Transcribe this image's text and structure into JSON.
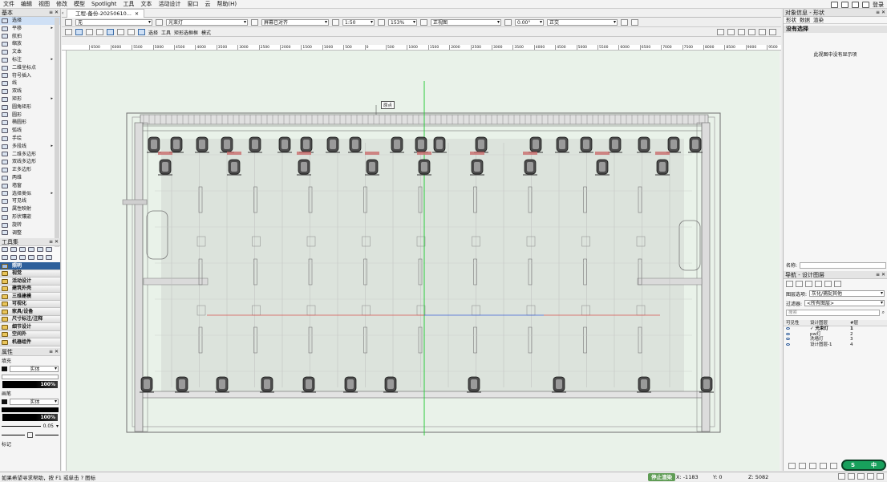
{
  "menubar": {
    "items": [
      "文件",
      "编辑",
      "视图",
      "修改",
      "模型",
      "Spotlight",
      "工具",
      "文本",
      "活动设计",
      "窗口",
      "云",
      "帮助(H)"
    ],
    "login": "登录"
  },
  "left_panel": {
    "basic_title": "基本",
    "basic_tools": [
      "选择",
      "平移",
      "航拍",
      "缩放",
      "文本",
      "标注",
      "二维坐标点",
      "符号插入",
      "线",
      "双线",
      "矩形",
      "圆角矩形",
      "圆形",
      "椭圆形",
      "弧线",
      "手绘",
      "多段线",
      "二维多边形",
      "双线多边形",
      "正多边形",
      "两维",
      "墙窗",
      "选择类似",
      "可见线",
      "属性映射",
      "形状镶嵌",
      "旋转",
      "调整"
    ],
    "toolsets_title": "工具集",
    "toolsets": [
      "照明",
      "视觉",
      "活动设计",
      "建筑外壳",
      "三维建模",
      "可视化",
      "家具/设备",
      "尺寸标注/注释",
      "细节设计",
      "空间外",
      "机器组件"
    ],
    "selected_toolset": "照明",
    "attributes_title": "属性",
    "fill_label": "填充",
    "fill_style": "实体",
    "fill_opacity": "100%",
    "pen_label": "画笔",
    "pen_style": "实体",
    "pen_opacity": "100%",
    "line_weight": "0.05",
    "marker_label": "标记"
  },
  "document": {
    "tab_title": "工程-备份-20250610...",
    "toolbar1": {
      "class_value": "无",
      "layer_value": "光束灯",
      "layer_option": "屏幕已对齐",
      "scale_value": "1:50",
      "zoom_value": "153%",
      "view_value": "正视图",
      "angle_value": "0.00°",
      "render_value": "正交"
    },
    "mode_bar_labels": [
      "选择",
      "工具",
      "矩形选框框",
      "模式"
    ],
    "ruler_ticks": [
      "",
      "6500",
      "6000",
      "5500",
      "5000",
      "4500",
      "4000",
      "3500",
      "3000",
      "2500",
      "2000",
      "1500",
      "1000",
      "500",
      "0",
      "500",
      "1000",
      "1500",
      "2000",
      "2500",
      "3000",
      "3500",
      "4000",
      "4500",
      "5000",
      "5500",
      "6000",
      "6500",
      "7000",
      "7500",
      "8000",
      "8500",
      "9000",
      "9500"
    ],
    "origin_label": "原点"
  },
  "right_panel": {
    "obj_info_title": "对象信息 - 形状",
    "obj_tabs": [
      "形状",
      "数据",
      "渲染"
    ],
    "no_selection": "没有选择",
    "no_selection_hint": "此视图中没有显示项",
    "name_label": "名称:",
    "nav_title": "导航 - 设计图层",
    "layer_option_label": "图层选项:",
    "layer_option_value": "灰化/捕捉其他",
    "filter_label": "过滤器:",
    "filter_value": "<所有图层>",
    "search_placeholder": "搜索",
    "layer_headers": [
      "可见性",
      "设计图层",
      "#层"
    ],
    "layers": [
      {
        "name": "光束灯",
        "num": "1",
        "active": true
      },
      {
        "name": "pw灯",
        "num": "2",
        "active": false
      },
      {
        "name": "洗墙灯",
        "num": "3",
        "active": false
      },
      {
        "name": "设计图层-1",
        "num": "4",
        "active": false
      }
    ]
  },
  "statusbar": {
    "help_text": "如果希望寻求帮助，按 F1 或单击 ? 图标",
    "render_btn": "停止渲染",
    "x": "X: -1183",
    "y": "Y: 0",
    "z": "Z: 5082"
  },
  "ime": {
    "logo": "S",
    "mode": "中"
  }
}
